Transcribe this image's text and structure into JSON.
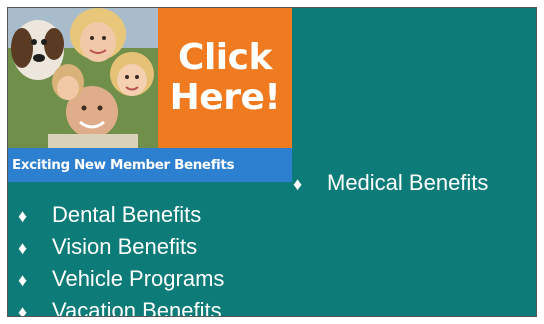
{
  "banner": {
    "cta_line1": "Click",
    "cta_line2": "Here!",
    "caption": "Exciting New Member Benefits"
  },
  "benefits": [
    {
      "label": "Medical Benefits"
    },
    {
      "label": "Dental Benefits"
    },
    {
      "label": "Vision Benefits"
    },
    {
      "label": "Vehicle Programs"
    },
    {
      "label": "Vacation Benefits"
    }
  ],
  "bullet_glyph": "♦",
  "colors": {
    "panel_background": "#0d7c78",
    "cta_orange": "#f07a1f",
    "caption_blue": "#2d7fd0",
    "text": "#ffffff"
  }
}
